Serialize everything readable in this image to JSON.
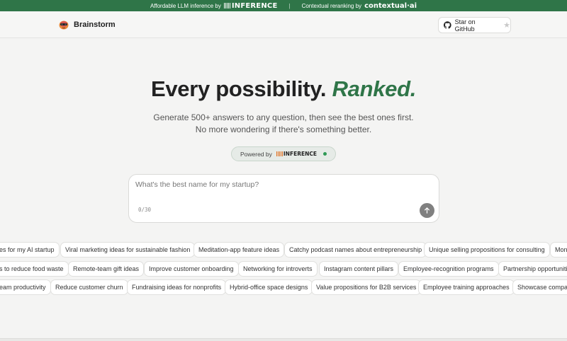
{
  "banner": {
    "left_text": "Affordable LLM inference by",
    "left_brand": "INFERENCE",
    "separator": "|",
    "right_text": "Contextual reranking by",
    "right_brand": "contextual·ai"
  },
  "header": {
    "app_name": "Brainstorm",
    "github_label": "Star on GitHub",
    "icons": [
      "brain-logo-icon",
      "github-icon",
      "star-icon"
    ]
  },
  "hero": {
    "title_main": "Every possibility.",
    "title_accent": "Ranked.",
    "subtitle": "Generate 500+ answers to any question, then see the best ones first. No more wondering if there's something better.",
    "powered_label": "Powered by",
    "powered_brand": "INFERENCE"
  },
  "input": {
    "placeholder": "What's the best name for my startup?",
    "value": "",
    "counter": "0/30"
  },
  "suggestions": {
    "row1": [
      "es for my AI startup",
      "Viral marketing ideas for sustainable fashion",
      "Meditation-app feature ideas",
      "Catchy podcast names about entrepreneurship",
      "Unique selling propositions for consulting",
      "Mon"
    ],
    "row2": [
      "s to reduce food waste",
      "Remote-team gift ideas",
      "Improve customer onboarding",
      "Networking for introverts",
      "Instagram content pillars",
      "Employee-recognition programs",
      "Partnership opportuniti"
    ],
    "row3": [
      "eam productivity",
      "Reduce customer churn",
      "Fundraising ideas for nonprofits",
      "Hybrid-office space designs",
      "Value propositions for B2B services",
      "Employee training approaches",
      "Showcase compan"
    ]
  },
  "colors": {
    "brand_green": "#2f7548",
    "background": "#f4f4f3",
    "send_button": "#808080"
  }
}
